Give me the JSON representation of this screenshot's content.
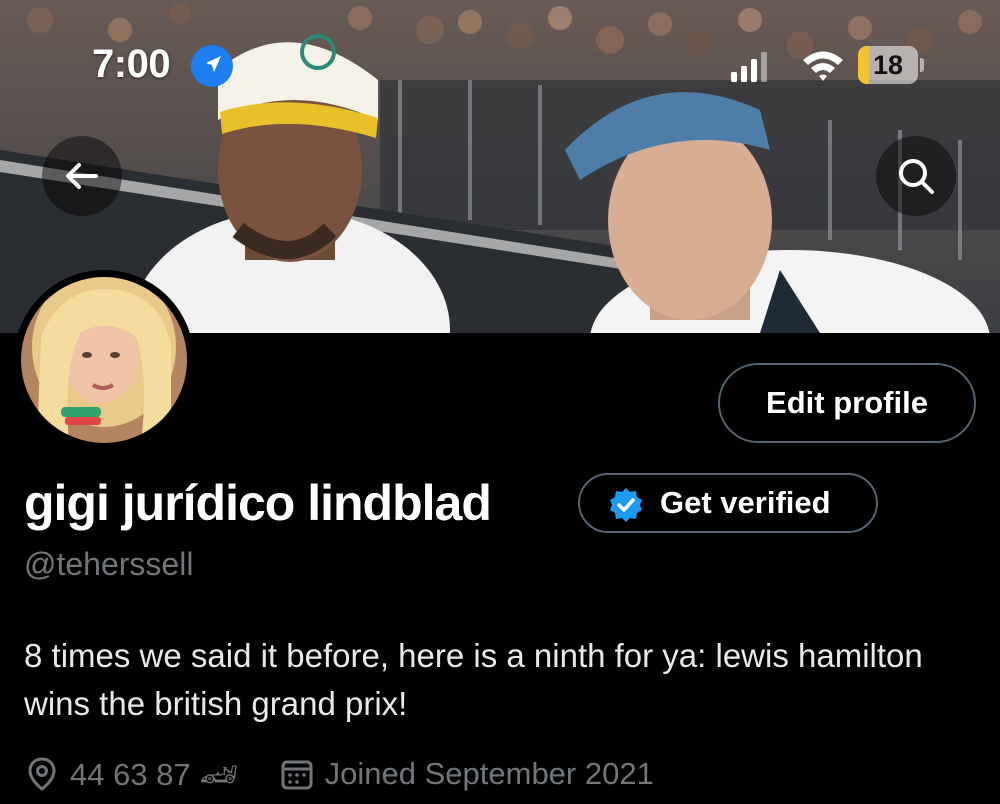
{
  "status_bar": {
    "time": "7:00",
    "battery_level": 18,
    "battery_label": "18"
  },
  "header": {
    "back_icon": "arrow-left-icon",
    "search_icon": "search-icon"
  },
  "profile": {
    "display_name": "gigi jurídico lindblad",
    "handle": "@teherssell",
    "edit_profile_label": "Edit profile",
    "get_verified_label": "Get verified",
    "bio": "8 times we said it before, here is a ninth for ya: lewis hamilton wins the british grand prix!",
    "location": "44 63 87 🏎",
    "joined": "Joined September 2021"
  },
  "colors": {
    "background": "#000000",
    "text_primary": "#e7e9ea",
    "text_secondary": "#71767b",
    "border": "#536471",
    "verified_blue": "#1d9bf0",
    "battery_yellow": "#f4c430"
  }
}
